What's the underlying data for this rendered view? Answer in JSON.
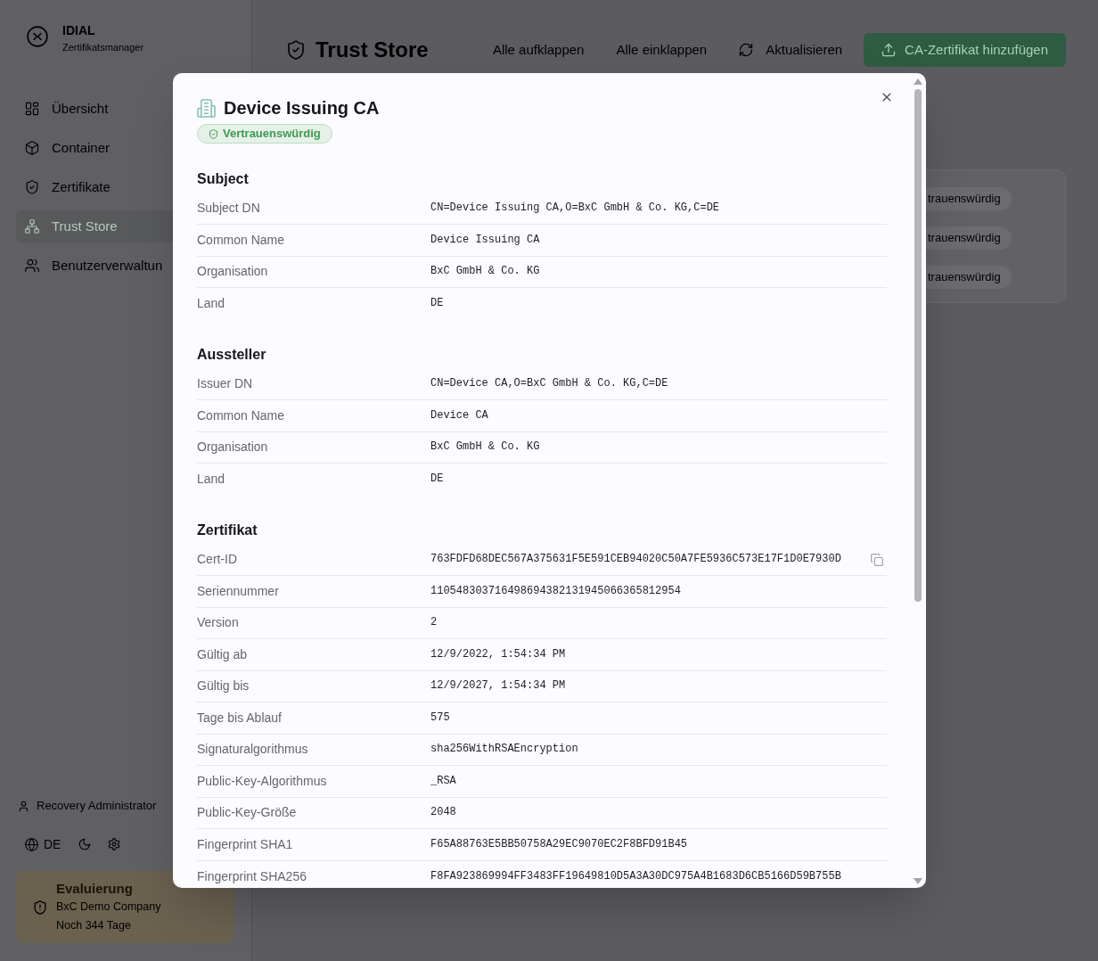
{
  "sidebar": {
    "brand": {
      "title": "IDIAL",
      "subtitle": "Zertifikatsmanager"
    },
    "nav_items": [
      {
        "label": "Übersicht",
        "selected": false
      },
      {
        "label": "Container",
        "selected": false
      },
      {
        "label": "Zertifikate",
        "selected": false
      },
      {
        "label": "Trust Store",
        "selected": true
      },
      {
        "label": "Benutzerverwaltun",
        "selected": false
      }
    ],
    "user": "Recovery Administrator",
    "language": "DE",
    "evaluation": {
      "title": "Evaluierung",
      "company": "BxC Demo Company",
      "remaining": "Noch 344 Tage"
    }
  },
  "header": {
    "title": "Trust Store",
    "actions": [
      {
        "label": "Alle aufklappen",
        "kind": "plain"
      },
      {
        "label": "Alle einklappen",
        "kind": "plain"
      },
      {
        "label": "Aktualisieren",
        "kind": "refresh"
      },
      {
        "label": "CA-Zertifikat hinzufügen",
        "kind": "primary"
      }
    ]
  },
  "trust_list": {
    "rows": [
      {
        "badge": "trauenswürdig"
      },
      {
        "badge": "trauenswürdig"
      },
      {
        "badge": "trauenswürdig"
      }
    ]
  },
  "dialog": {
    "title": "Device Issuing CA",
    "status": "Vertrauenswürdig",
    "sections": [
      {
        "heading": "Subject",
        "rows": [
          {
            "label": "Subject DN",
            "value": "CN=Device Issuing CA,O=BxC GmbH & Co. KG,C=DE",
            "kind": "text"
          },
          {
            "label": "Common Name",
            "value": "Device Issuing CA",
            "kind": "text"
          },
          {
            "label": "Organisation",
            "value": "BxC GmbH & Co. KG",
            "kind": "text"
          },
          {
            "label": "Land",
            "value": "DE",
            "kind": "text"
          }
        ]
      },
      {
        "heading": "Aussteller",
        "rows": [
          {
            "label": "Issuer DN",
            "value": "CN=Device CA,O=BxC GmbH & Co. KG,C=DE",
            "kind": "text"
          },
          {
            "label": "Common Name",
            "value": "Device CA",
            "kind": "text"
          },
          {
            "label": "Organisation",
            "value": "BxC GmbH & Co. KG",
            "kind": "text"
          },
          {
            "label": "Land",
            "value": "DE",
            "kind": "text"
          }
        ]
      },
      {
        "heading": "Zertifikat",
        "rows": [
          {
            "label": "Cert-ID",
            "value": "763FDFD68DEC567A375631F5E591CEB94020C50A7FE5936C573E17F1D0E7930D",
            "kind": "copyable"
          },
          {
            "label": "Seriennummer",
            "value": "110548303716498694382131945066365812954",
            "kind": "text"
          },
          {
            "label": "Version",
            "value": "2",
            "kind": "text"
          },
          {
            "label": "Gültig ab",
            "value": "12/9/2022, 1:54:34 PM",
            "kind": "text"
          },
          {
            "label": "Gültig bis",
            "value": "12/9/2027, 1:54:34 PM",
            "kind": "text"
          },
          {
            "label": "Tage bis Ablauf",
            "value": "575",
            "kind": "text"
          },
          {
            "label": "Signaturalgorithmus",
            "value": "sha256WithRSAEncryption",
            "kind": "text"
          },
          {
            "label": "Public-Key-Algorithmus",
            "value": "_RSA",
            "kind": "text"
          },
          {
            "label": "Public-Key-Größe",
            "value": "2048",
            "kind": "text"
          },
          {
            "label": "Fingerprint SHA1",
            "value": "F65A88763E5BB50758A29EC9070EC2F8BFD91B45",
            "kind": "text"
          },
          {
            "label": "Fingerprint SHA256",
            "value": "F8FA923869994FF3483FF19649810D5A3A30DC975A4B1683D6CB5166D59B755B",
            "kind": "text"
          }
        ]
      }
    ]
  }
}
